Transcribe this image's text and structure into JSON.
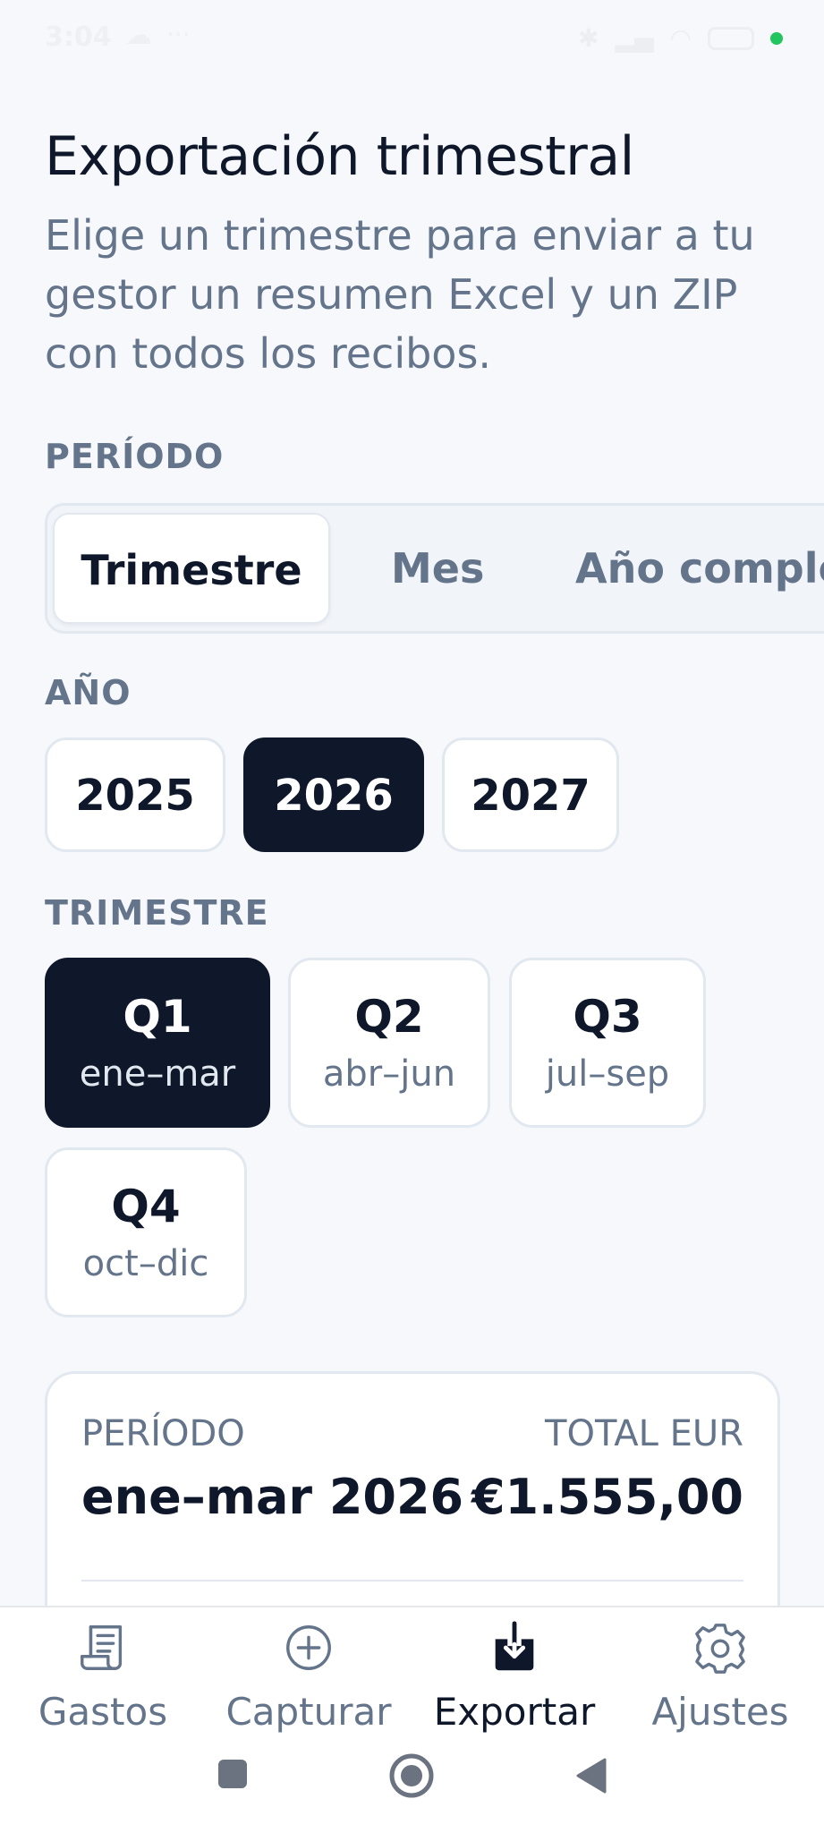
{
  "status_bar": {
    "time": "3:04"
  },
  "header": {
    "title": "Exportación trimestral",
    "subtitle": "Elige un trimestre para enviar a tu gestor un resumen Excel y un ZIP con todos los recibos."
  },
  "period": {
    "label": "PERÍODO",
    "options": [
      "Trimestre",
      "Mes",
      "Año comple"
    ],
    "selected": "Trimestre"
  },
  "year": {
    "label": "AÑO",
    "options": [
      "2025",
      "2026",
      "2027"
    ],
    "selected": "2026"
  },
  "quarter": {
    "label": "TRIMESTRE",
    "options": [
      {
        "name": "Q1",
        "range": "ene–mar"
      },
      {
        "name": "Q2",
        "range": "abr–jun"
      },
      {
        "name": "Q3",
        "range": "jul–sep"
      },
      {
        "name": "Q4",
        "range": "oct–dic"
      }
    ],
    "selected": "Q1"
  },
  "summary": {
    "period_label": "PERÍODO",
    "period_value": "ene–mar 2026",
    "total_label": "TOTAL EUR",
    "total_value": "€1.555,00"
  },
  "bottom_nav": {
    "items": [
      {
        "label": "Gastos",
        "icon": "receipt-icon"
      },
      {
        "label": "Capturar",
        "icon": "plus-circle-icon"
      },
      {
        "label": "Exportar",
        "icon": "export-download-icon"
      },
      {
        "label": "Ajustes",
        "icon": "gear-icon"
      }
    ],
    "active": "Exportar"
  },
  "colors": {
    "background": "#f6f8fb",
    "selected": "#0f172a",
    "muted_text": "#64748b",
    "border": "#e2e8f0"
  }
}
